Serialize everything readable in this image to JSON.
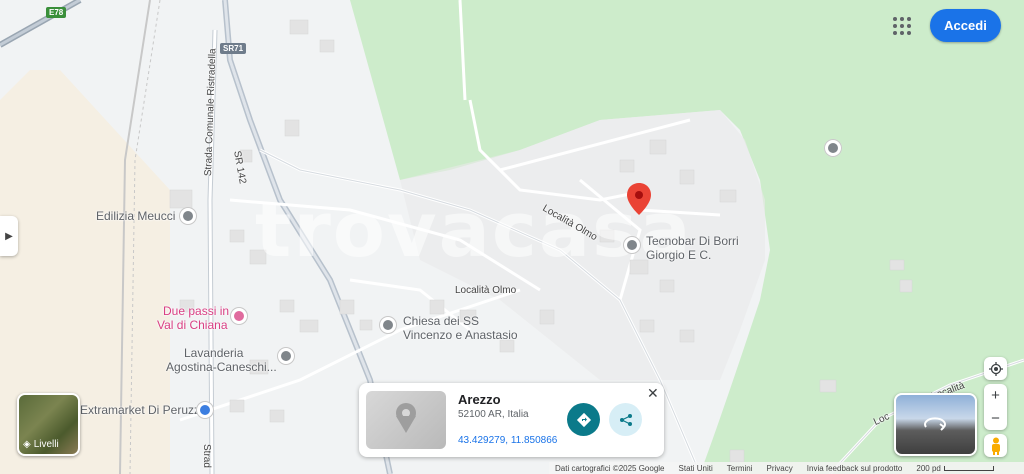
{
  "header": {
    "login_label": "Accedi"
  },
  "map": {
    "watermark": "trovacasa",
    "road_labels": {
      "e78": "E78",
      "sr71": "SR71",
      "sr142": "SR 142",
      "strada_comunale": "Strada Comunale Ristradella",
      "localita_olmo_1": "Località Olmo",
      "localita_olmo_2": "Località Olmo",
      "loc_1": "Loc",
      "loc_2": "Località",
      "stra": "Strad"
    },
    "places": {
      "edilizia": "Edilizia Meucci",
      "tecnobar_line1": "Tecnobar Di Borri",
      "tecnobar_line2": "Giorgio E C.",
      "due_passi_line1": "Due passi in",
      "due_passi_line2": "Val di Chiana",
      "chiesa_line1": "Chiesa dei SS",
      "chiesa_line2": "Vincenzo e Anastasio",
      "lavanderia_line1": "Lavanderia",
      "lavanderia_line2": "Agostina-Caneschi...",
      "extramarket": "Extramarket Di Peruzzi"
    }
  },
  "layers": {
    "label": "Livelli"
  },
  "card": {
    "title": "Arezzo",
    "address": "52100 AR, Italia",
    "coords": "43.429279, 11.850866"
  },
  "footer": {
    "data": "Dati cartografici ©2025 Google",
    "country": "Stati Uniti",
    "terms": "Termini",
    "privacy": "Privacy",
    "feedback": "Invia feedback sul prodotto",
    "scale": "200 pd"
  },
  "colors": {
    "green_area": "#cdeccb",
    "accent": "#1a73e8",
    "pin": "#ea4335"
  }
}
